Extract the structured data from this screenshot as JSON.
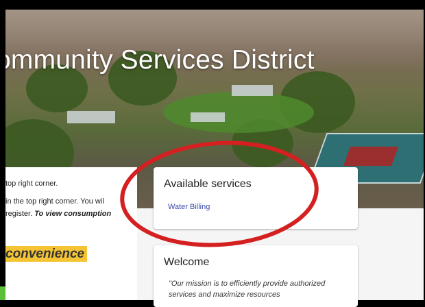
{
  "hero": {
    "title": "ommunity Services District"
  },
  "left_panel": {
    "line1": "top right corner.",
    "line2": "in the top right corner. You wil",
    "line3_text": "register. ",
    "line3_emphasis": "To view consumption",
    "highlight": "convenience"
  },
  "services_card": {
    "title": "Available services",
    "link": "Water Billing"
  },
  "welcome_card": {
    "title": "Welcome",
    "text": "\"Our mission is to efficiently provide authorized services and maximize resources"
  },
  "colors": {
    "annotation": "#d42020",
    "highlight": "#f4c434",
    "link": "#3949ab",
    "corner_accent": "#5bbf3a"
  }
}
